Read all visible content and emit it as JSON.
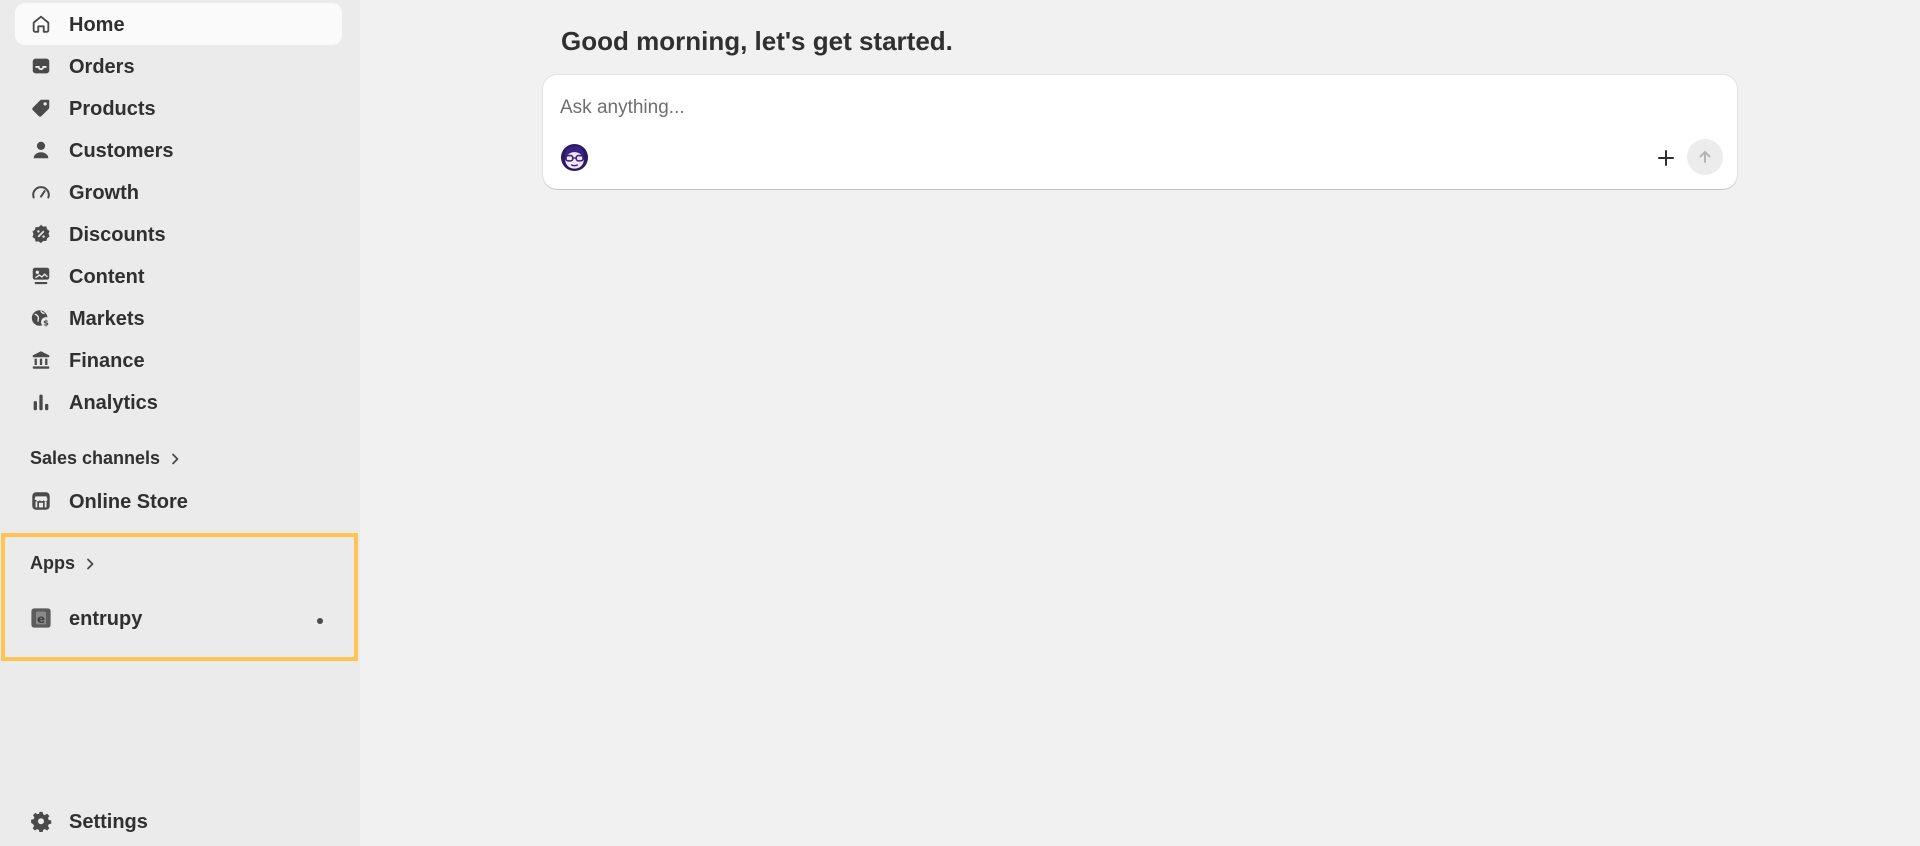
{
  "sidebar": {
    "items": [
      {
        "label": "Home",
        "icon": "home-icon",
        "active": true
      },
      {
        "label": "Orders",
        "icon": "inbox-icon"
      },
      {
        "label": "Products",
        "icon": "tag-icon"
      },
      {
        "label": "Customers",
        "icon": "person-icon"
      },
      {
        "label": "Growth",
        "icon": "gauge-icon"
      },
      {
        "label": "Discounts",
        "icon": "discount-icon"
      },
      {
        "label": "Content",
        "icon": "image-icon"
      },
      {
        "label": "Markets",
        "icon": "globe-icon"
      },
      {
        "label": "Finance",
        "icon": "bank-icon"
      },
      {
        "label": "Analytics",
        "icon": "bar-chart-icon"
      }
    ],
    "sales_channels": {
      "header": "Sales channels",
      "items": [
        {
          "label": "Online Store",
          "icon": "store-icon"
        }
      ]
    },
    "apps": {
      "header": "Apps",
      "items": [
        {
          "label": "entrupy",
          "icon": "entrupy-logo-icon"
        }
      ]
    },
    "settings": {
      "label": "Settings",
      "icon": "gear-icon"
    }
  },
  "main": {
    "greeting": "Good morning, let's get started.",
    "chat": {
      "placeholder": "Ask anything...",
      "avatar_icon": "sidekick-avatar-icon",
      "add_icon": "plus-icon",
      "send_icon": "arrow-up-icon"
    }
  },
  "colors": {
    "sidebar_bg": "#ebebeb",
    "main_bg": "#f1f1f1",
    "active_item_bg": "#fafafa",
    "highlight_border": "#ffc453",
    "text": "#303030"
  }
}
